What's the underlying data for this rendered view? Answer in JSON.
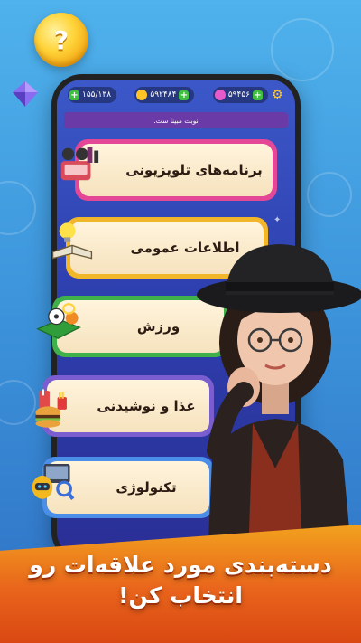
{
  "status": {
    "gems": "۵۹۴۵۶",
    "coins": "۵۹۲۴۸۴",
    "energy": "۱۵۵/۱۳۸"
  },
  "turn_text": "نوبت مبینا ست.",
  "categories": [
    {
      "label": "برنامه‌های تلویزیونی",
      "icon": "tv-shows-icon",
      "color": "#e34796"
    },
    {
      "label": "اطلاعات عمومی",
      "icon": "general-knowledge-icon",
      "color": "#f1b62a"
    },
    {
      "label": "ورزش",
      "icon": "sports-icon",
      "color": "#3eb14b"
    },
    {
      "label": "غذا و نوشیدنی",
      "icon": "food-drink-icon",
      "color": "#7a5ecf"
    },
    {
      "label": "تکنولوژی",
      "icon": "technology-icon",
      "color": "#4a8ee8"
    }
  ],
  "banner": {
    "line1": "دسته‌بندی مورد علاقه‌ات رو",
    "line2": "انتخاب کن!"
  },
  "coin_symbol": "?"
}
